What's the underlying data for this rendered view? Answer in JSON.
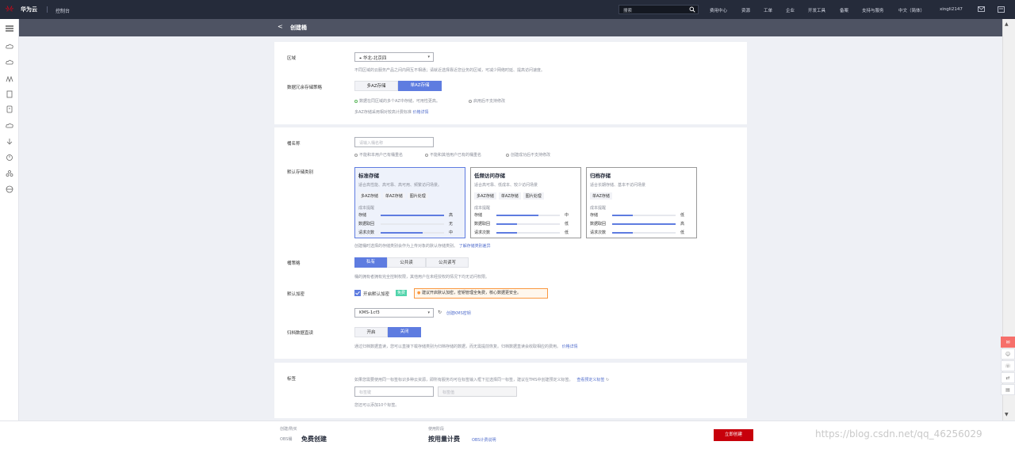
{
  "topbar": {
    "logo_text": "HUAWEI",
    "brand": "华为云",
    "console": "控制台",
    "search_placeholder": "搜索",
    "nav": [
      "费用中心",
      "资源",
      "工单",
      "企业",
      "开发工具",
      "备案",
      "支持与服务",
      "中文（简体）",
      "xingli2147"
    ]
  },
  "page": {
    "title": "创建桶",
    "back": "<"
  },
  "region": {
    "label": "区域",
    "value": "华北-北京四",
    "hint": "不同区域的云服务产品之间内网互不相通；请就近选择靠近您业务的区域，可减少网络时延、提高访问速度。"
  },
  "redundancy": {
    "label": "数据冗余存储策略",
    "options": [
      "多AZ存储",
      "单AZ存储"
    ],
    "selected": "单AZ存储",
    "note1": "数据在同区域的多个AZ中存储，可用性更高。",
    "note2": "启用后不支持修改",
    "note3": "多AZ存储采用相对较高计费标准",
    "note3_link": "价格详情"
  },
  "bucket": {
    "label": "桶名称",
    "placeholder": "请输入桶名称",
    "rules": [
      "不能和本用户已有桶重名",
      "不能和其他用户已有的桶重名",
      "创建成功后不支持修改"
    ]
  },
  "storage_class": {
    "label": "默认存储类别",
    "cards": [
      {
        "title": "标准存储",
        "desc": "适合高性能、高可靠、高可用、频繁访问场景。",
        "tags": [
          "多AZ存储",
          "单AZ存储",
          "图片处理"
        ],
        "cost_label": "成本提醒",
        "rows": [
          {
            "k": "存储",
            "v": "高",
            "p": 1.0
          },
          {
            "k": "数据取回",
            "v": "无",
            "p": 0.0
          },
          {
            "k": "请求次数",
            "v": "中",
            "p": 0.66
          }
        ]
      },
      {
        "title": "低频访问存储",
        "desc": "适合高可靠、低成本、较少访问场景",
        "tags": [
          "多AZ存储",
          "单AZ存储",
          "图片处理"
        ],
        "cost_label": "成本提醒",
        "rows": [
          {
            "k": "存储",
            "v": "中",
            "p": 0.66
          },
          {
            "k": "数据取回",
            "v": "低",
            "p": 0.33
          },
          {
            "k": "请求次数",
            "v": "低",
            "p": 0.33
          }
        ]
      },
      {
        "title": "归档存储",
        "desc": "适合长期存储、基本不访问场景",
        "tags": [
          "单AZ存储"
        ],
        "cost_label": "成本提醒",
        "rows": [
          {
            "k": "存储",
            "v": "低",
            "p": 0.33
          },
          {
            "k": "数据取回",
            "v": "高",
            "p": 1.0
          },
          {
            "k": "请求次数",
            "v": "低",
            "p": 0.33
          }
        ]
      }
    ],
    "hint": "创建桶时选择的存储类别会作为上传对象的默认存储类别。",
    "hint_link": "了解存储类别差异"
  },
  "policy": {
    "label": "桶策略",
    "options": [
      "私有",
      "公共读",
      "公共读写"
    ],
    "selected": "私有",
    "hint": "桶的拥有者拥有完全控制权限，其他用户在未经授权的情况下均无访问权限。"
  },
  "encryption": {
    "label": "默认加密",
    "checkbox": "开启默认加密",
    "badge": "免费",
    "tip": "建议开启默认加密，密钥管理全免费，核心数据更安全。",
    "kms_value": "KMS-1cf3",
    "kms_link": "创建KMS密钥"
  },
  "archive": {
    "label": "归档数据直读",
    "options": [
      "开启",
      "关闭"
    ],
    "selected": "关闭",
    "hint": "通过归档数据直读，您可以直接下载存储类别为归档存储的数据，而无需提前恢复。归档数据直读会收取相应的费用。",
    "hint_link": "价格详情"
  },
  "tags": {
    "label": "标签",
    "hint": "如果您需要使用同一标签标识多种云资源，即所有服务均可在标签输入框下拉选择同一标签，建议在TMS中创建预定义标签。",
    "link": "查看预定义标签",
    "key_ph": "标签键",
    "value_ph": "标签值",
    "count_hint": "您还可以添加10个标签。"
  },
  "footer": {
    "col1_head": "创建/购买",
    "col1_sub": "OBS桶",
    "col1_price": "免费创建",
    "col2_head": "使用阶段",
    "col2_price": "按用量计费",
    "col2_link": "OBS计费说明",
    "buy": "立即创建",
    "watermark": "https://blog.csdn.net/qq_46256029"
  },
  "colors": {
    "accent": "#5e7ce0",
    "topbar": "#252b3a",
    "buy": "#c7000b"
  }
}
